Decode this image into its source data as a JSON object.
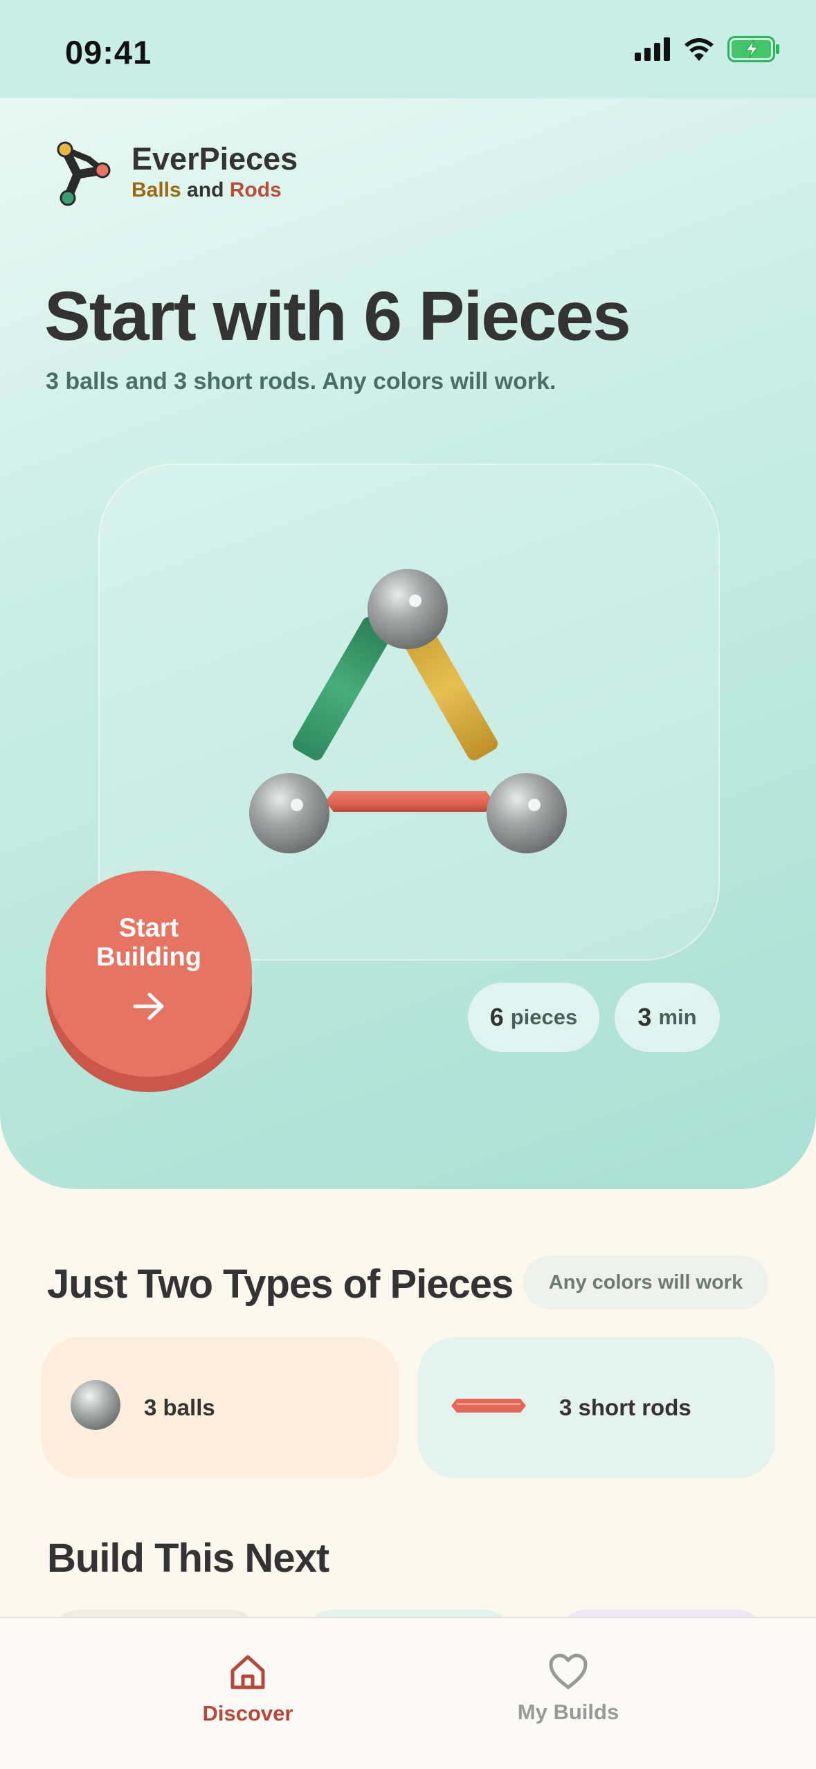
{
  "status_bar": {
    "time": "09:41",
    "icons": [
      "signal-icon",
      "wifi-icon",
      "battery-charging-icon"
    ]
  },
  "brand": {
    "name": "EverPieces",
    "sub_balls": "Balls",
    "sub_and": " and ",
    "sub_rods": "Rods"
  },
  "hero": {
    "title": "Start with 6 Pieces",
    "subtitle": "3 balls and 3 short rods. Any colors will work.",
    "start_button": {
      "line1": "Start",
      "line2": "Building",
      "icon": "arrow-right-icon"
    },
    "chips": [
      {
        "value": "6",
        "unit": "pieces"
      },
      {
        "value": "3",
        "unit": "min"
      }
    ]
  },
  "types_section": {
    "title": "Just Two Types of Pieces",
    "colors_pill": "Any colors will work",
    "cards": [
      {
        "icon": "ball-icon",
        "label": "3 balls"
      },
      {
        "icon": "rod-icon",
        "label": "3 short rods"
      }
    ]
  },
  "next_section": {
    "title": "Build This Next"
  },
  "tabs": [
    {
      "icon": "home-icon",
      "label": "Discover",
      "active": true
    },
    {
      "icon": "heart-icon",
      "label": "My Builds",
      "active": false
    }
  ],
  "colors": {
    "accent": "#e57462",
    "accent_text": "#b5483b",
    "hero_bg": "#c8ede4",
    "rod_green": "#3a9e6e",
    "rod_yellow": "#dcb443",
    "rod_red": "#e06a57",
    "ball_gray": "#9a9c9c"
  }
}
